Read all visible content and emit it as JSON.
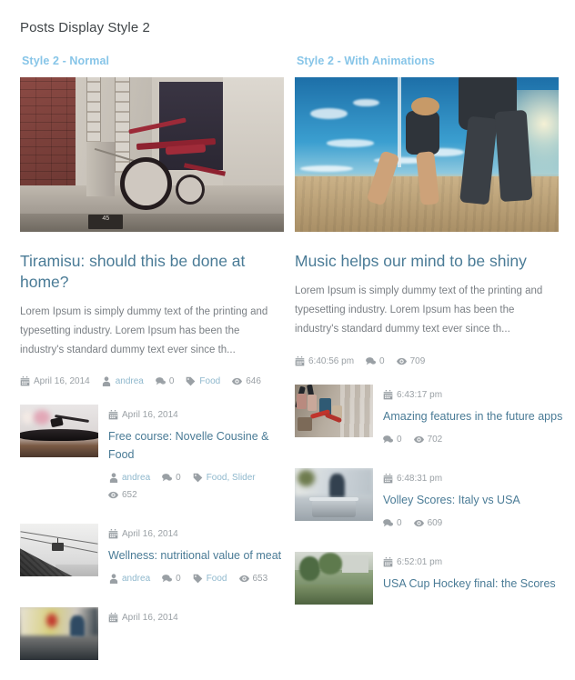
{
  "page": {
    "title": "Posts Display Style 2"
  },
  "columns": [
    {
      "heading": "Style 2 - Normal",
      "featured": {
        "image_name": "vintage-tricycle-photo",
        "title": "Tiramisu: should this be done at home?",
        "excerpt": "Lorem Ipsum is simply dummy text of the printing and typesetting industry. Lorem Ipsum has been the industry's standard dummy text ever since th...",
        "meta": {
          "date": "April 16, 2014",
          "author": "andrea",
          "comments": "0",
          "category": "Food",
          "views": "646"
        }
      },
      "list": [
        {
          "thumb_name": "turntable-thumbnail",
          "date": "April 16, 2014",
          "title": "Free course: Novelle Cousine & Food",
          "author": "andrea",
          "comments": "0",
          "category": "Food, Slider",
          "views": "652"
        },
        {
          "thumb_name": "cable-car-thumbnail",
          "date": "April 16, 2014",
          "title": "Wellness: nutritional value of meat",
          "author": "andrea",
          "comments": "0",
          "category": "Food",
          "views": "653"
        },
        {
          "thumb_name": "kitchen-thumbnail",
          "date": "April 16, 2014",
          "title": "",
          "author": "",
          "comments": "",
          "category": "",
          "views": ""
        }
      ]
    },
    {
      "heading": "Style 2 - With Animations",
      "featured": {
        "image_name": "beach-volleyball-photo",
        "title": "Music helps our mind to be shiny",
        "excerpt": "Lorem Ipsum is simply dummy text of the printing and typesetting industry. Lorem Ipsum has been the industry's standard dummy text ever since th...",
        "meta": {
          "date": "6:40:56 pm",
          "author": "",
          "comments": "0",
          "category": "",
          "views": "709"
        }
      },
      "list": [
        {
          "thumb_name": "padlocks-thumbnail",
          "date": "6:43:17 pm",
          "title": "Amazing features in the future apps",
          "author": "",
          "comments": "0",
          "category": "",
          "views": "702"
        },
        {
          "thumb_name": "bench-thumbnail",
          "date": "6:48:31 pm",
          "title": "Volley Scores: Italy vs USA",
          "author": "",
          "comments": "0",
          "category": "",
          "views": "609"
        },
        {
          "thumb_name": "park-thumbnail",
          "date": "6:52:01 pm",
          "title": "USA Cup Hockey final: the Scores",
          "author": "",
          "comments": "",
          "category": "",
          "views": ""
        }
      ]
    }
  ],
  "icons": {
    "calendar": "calendar-icon",
    "user": "user-icon",
    "comment": "comment-icon",
    "tag": "tag-icon",
    "eye": "eye-icon"
  },
  "colors": {
    "heading_blue": "#87c5e8",
    "link_blue": "#4a7b96",
    "meta_gray": "#9aa0a5",
    "body_gray": "#7a7f84",
    "title_dark": "#3f4447"
  }
}
